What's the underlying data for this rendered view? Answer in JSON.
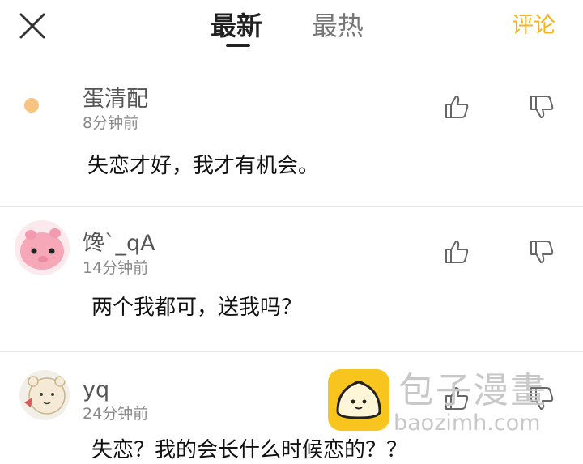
{
  "header": {
    "tabs": [
      {
        "label": "最新",
        "active": true
      },
      {
        "label": "最热",
        "active": false
      }
    ],
    "comment_label": "评论",
    "accent_color": "#f5b21f"
  },
  "comments": [
    {
      "username": "蛋清配",
      "time": "8分钟前",
      "content": "失恋才好，我才有机会。"
    },
    {
      "username": "馋`_qA",
      "time": "14分钟前",
      "content": "两个我都可，送我吗？"
    },
    {
      "username": "yq",
      "time": "24分钟前",
      "content": "失恋？我的会长什么时候恋的？？"
    }
  ],
  "watermark": {
    "name": "包子漫畫",
    "url": "baozimh.com"
  },
  "icons": {
    "close": "close-icon",
    "like": "thumbs-up-icon",
    "dislike": "thumbs-down-icon"
  }
}
